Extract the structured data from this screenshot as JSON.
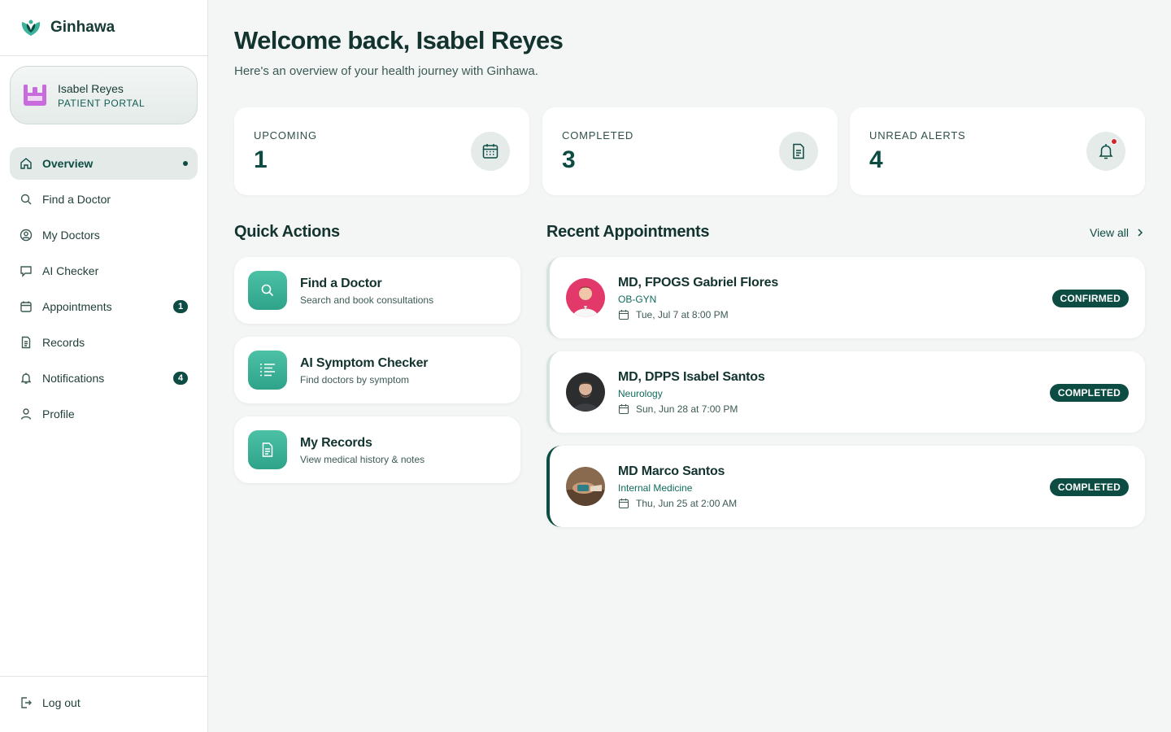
{
  "brand": {
    "name": "Ginhawa"
  },
  "user": {
    "name": "Isabel Reyes",
    "role": "PATIENT PORTAL"
  },
  "nav": [
    {
      "label": "Overview",
      "icon": "home-icon",
      "active": true
    },
    {
      "label": "Find a Doctor",
      "icon": "search-icon"
    },
    {
      "label": "My Doctors",
      "icon": "user-circle-icon"
    },
    {
      "label": "AI Checker",
      "icon": "chat-icon"
    },
    {
      "label": "Appointments",
      "icon": "calendar-icon",
      "badge": "1"
    },
    {
      "label": "Records",
      "icon": "document-icon"
    },
    {
      "label": "Notifications",
      "icon": "bell-icon",
      "badge": "4"
    },
    {
      "label": "Profile",
      "icon": "user-icon"
    }
  ],
  "logout": {
    "label": "Log out"
  },
  "header": {
    "title": "Welcome back, Isabel Reyes",
    "subtitle": "Here's an overview of your health journey with Ginhawa."
  },
  "stats": [
    {
      "label": "UPCOMING",
      "value": "1",
      "icon": "calendar-icon"
    },
    {
      "label": "COMPLETED",
      "value": "3",
      "icon": "document-icon"
    },
    {
      "label": "UNREAD ALERTS",
      "value": "4",
      "icon": "bell-icon"
    }
  ],
  "quick_actions": {
    "title": "Quick Actions",
    "items": [
      {
        "title": "Find a Doctor",
        "desc": "Search and book consultations",
        "icon": "search-icon"
      },
      {
        "title": "AI Symptom Checker",
        "desc": "Find doctors by symptom",
        "icon": "list-icon"
      },
      {
        "title": "My Records",
        "desc": "View medical history & notes",
        "icon": "document-icon"
      }
    ]
  },
  "recent": {
    "title": "Recent Appointments",
    "view_all": "View all",
    "items": [
      {
        "name": "MD, FPOGS Gabriel Flores",
        "specialty": "OB-GYN",
        "date": "Tue, Jul 7 at 8:00 PM",
        "status": "CONFIRMED"
      },
      {
        "name": "MD, DPPS Isabel Santos",
        "specialty": "Neurology",
        "date": "Sun, Jun 28 at 7:00 PM",
        "status": "COMPLETED"
      },
      {
        "name": "MD Marco Santos",
        "specialty": "Internal Medicine",
        "date": "Thu, Jun 25 at 2:00 AM",
        "status": "COMPLETED"
      }
    ]
  },
  "colors": {
    "accent": "#0d4c43",
    "teal": "#3bb39a",
    "alert": "#d6262b",
    "avatar_purple": "#c86bdc"
  }
}
